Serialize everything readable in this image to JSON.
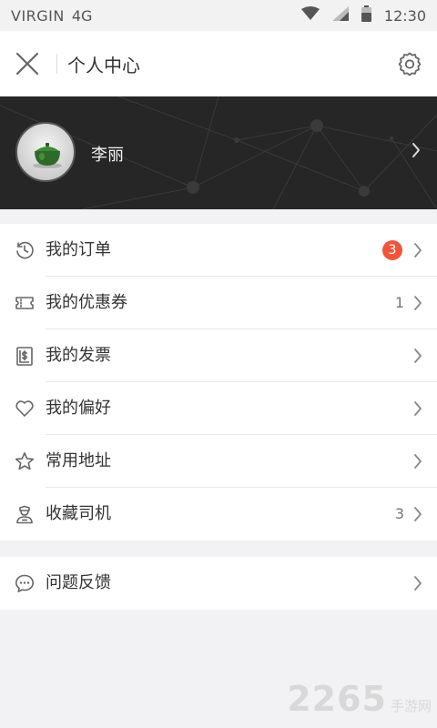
{
  "status_bar": {
    "carrier": "VIRGIN",
    "network": "4G",
    "time": "12:30"
  },
  "header": {
    "title": "个人中心"
  },
  "profile": {
    "name": "李丽"
  },
  "menu": [
    {
      "label": "我的订单",
      "badge": "3",
      "icon": "clock-icon"
    },
    {
      "label": "我的优惠券",
      "count": "1",
      "icon": "ticket-icon"
    },
    {
      "label": "我的发票",
      "icon": "invoice-icon"
    },
    {
      "label": "我的偏好",
      "icon": "heart-icon"
    },
    {
      "label": "常用地址",
      "icon": "star-icon"
    },
    {
      "label": "收藏司机",
      "count": "3",
      "icon": "driver-icon"
    }
  ],
  "menu2": [
    {
      "label": "问题反馈",
      "icon": "chat-bubble-icon"
    }
  ],
  "watermark": {
    "number": "2265",
    "suffix": "手游网"
  },
  "colors": {
    "badge": "#f0553a",
    "profile_bg": "#262626",
    "page_bg": "#f2f2f4"
  }
}
